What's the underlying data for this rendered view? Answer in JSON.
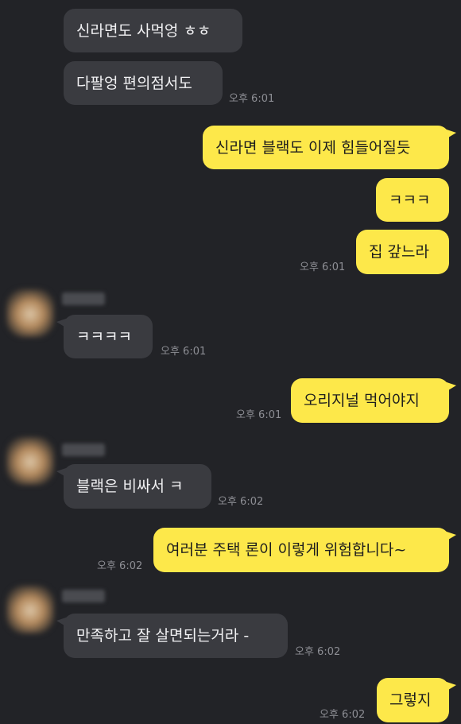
{
  "chat": {
    "messages": [
      {
        "side": "in",
        "text": "신라면도 사먹엉 ㅎㅎ",
        "time": ""
      },
      {
        "side": "in",
        "text": "다팔엉 편의점서도",
        "time": "오후 6:01"
      },
      {
        "side": "out",
        "text": "신라면 블랙도 이제 힘들어질듯",
        "time": ""
      },
      {
        "side": "out",
        "text": "ㅋㅋㅋ",
        "time": ""
      },
      {
        "side": "out",
        "text": "집 갚느라",
        "time": "오후 6:01"
      },
      {
        "side": "in",
        "text": "ㅋㅋㅋㅋ",
        "time": "오후 6:01"
      },
      {
        "side": "out",
        "text": "오리지널 먹어야지",
        "time": "오후 6:01"
      },
      {
        "side": "in",
        "text": "블랙은 비싸서 ㅋ",
        "time": "오후 6:02"
      },
      {
        "side": "out",
        "text": "여러분 주택 론이 이렇게 위험합니다~",
        "time": "오후 6:02"
      },
      {
        "side": "in",
        "text": "만족하고 잘 살면되는거라 -",
        "time": "오후 6:02"
      },
      {
        "side": "out",
        "text": "그렇지",
        "time": "오후 6:02"
      }
    ]
  }
}
